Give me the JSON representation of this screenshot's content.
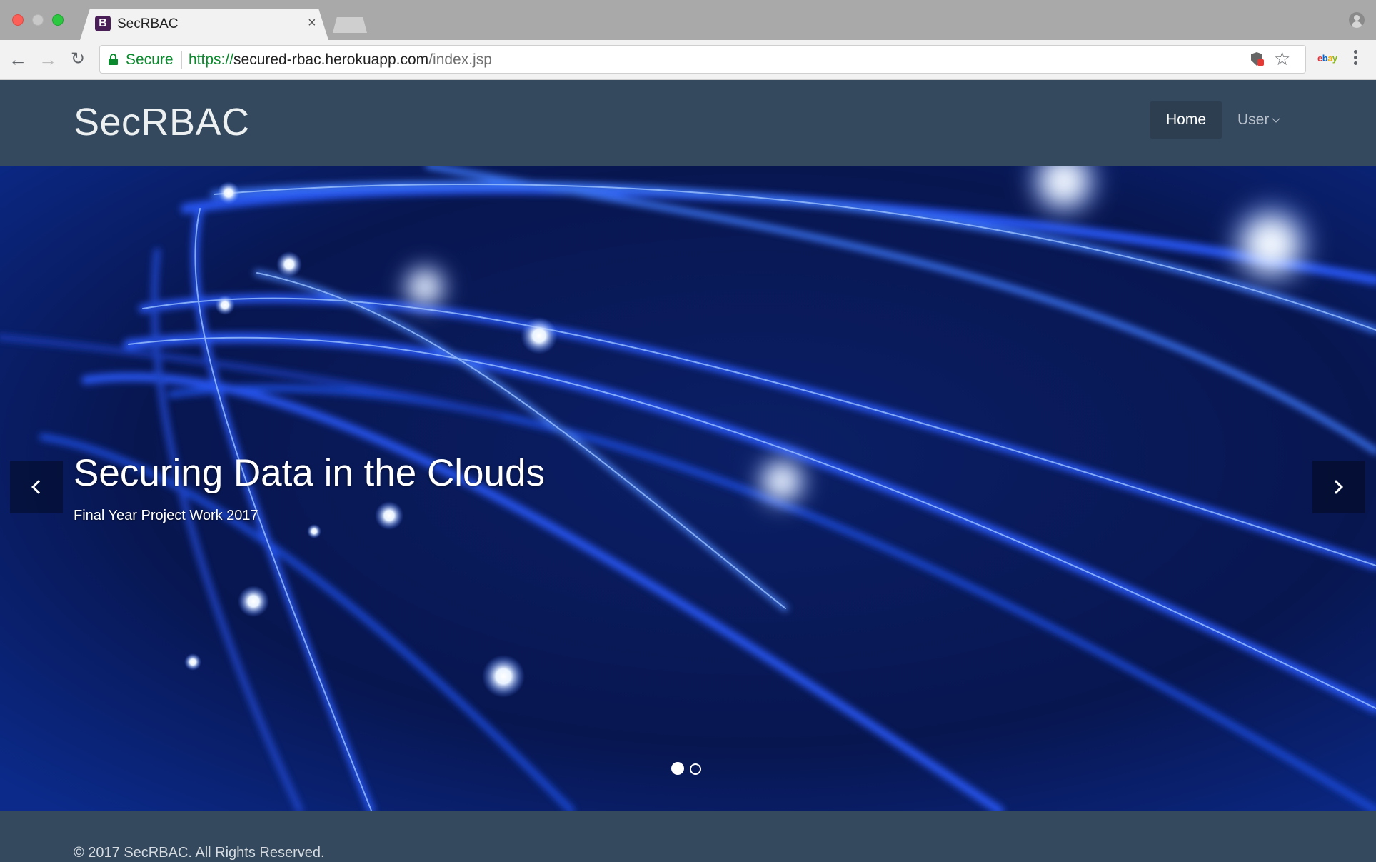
{
  "browser": {
    "tab_title": "SecRBAC",
    "tab_favicon_letter": "B",
    "tab_close": "×",
    "secure_label": "Secure",
    "url_scheme": "https://",
    "url_host": "secured-rbac.herokuapp.com",
    "url_path": "/index.jsp",
    "icons": [
      "back-arrow-icon",
      "forward-arrow-icon",
      "reload-icon",
      "lock-icon",
      "shield-extension-icon",
      "star-icon",
      "ebay-extension-icon",
      "menu-icon",
      "profile-icon"
    ]
  },
  "site": {
    "brand": "SecRBAC",
    "nav": {
      "home": "Home",
      "user": "User"
    },
    "carousel": {
      "title": "Securing Data in the Clouds",
      "subtitle": "Final Year Project Work 2017",
      "slide_count": 2,
      "active_slide": 1
    },
    "footer": "© 2017 SecRBAC. All Rights Reserved."
  },
  "colors": {
    "navbar": "#34495e",
    "nav_active": "#2c3e50",
    "secure_green": "#0b8a2d",
    "carousel_bg": "#0a1a4a"
  }
}
